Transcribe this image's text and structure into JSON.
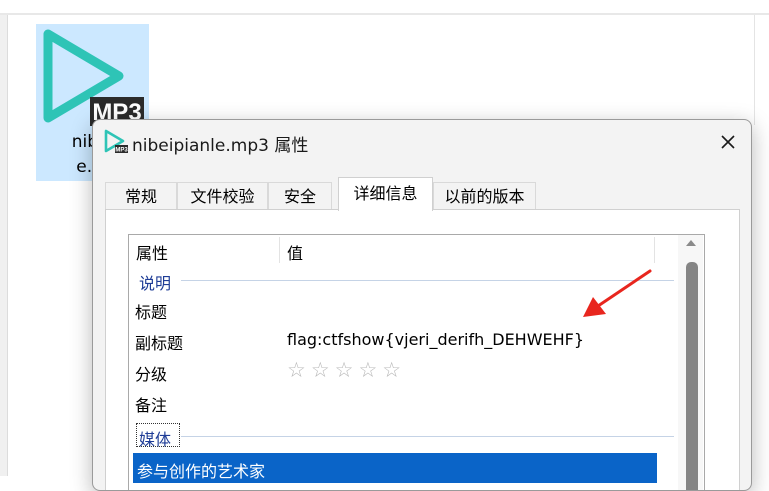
{
  "file": {
    "name_line1": "nibei",
    "name_line2": "e.m",
    "badge": "MP3"
  },
  "dialog": {
    "title": "nibeipianle.mp3 属性",
    "tabs": [
      {
        "label": "常规"
      },
      {
        "label": "文件校验"
      },
      {
        "label": "安全"
      },
      {
        "label": "详细信息"
      },
      {
        "label": "以前的版本"
      }
    ],
    "active_tab": "详细信息",
    "columns": {
      "property": "属性",
      "value": "值"
    },
    "groups": {
      "description": "说明",
      "media": "媒体"
    },
    "rows": [
      {
        "name": "标题",
        "value": ""
      },
      {
        "name": "副标题",
        "value": "flag:ctfshow{vjeri_derifh_DEHWEHF}"
      },
      {
        "name": "分级",
        "value": "☆☆☆☆☆"
      },
      {
        "name": "备注",
        "value": ""
      }
    ],
    "rating_stars": 0,
    "selected_row": "参与创作的艺术家"
  },
  "colors": {
    "accent": "#0a64c8",
    "group_text": "#1e3c96",
    "annotation_arrow": "#e8261e",
    "icon_teal": "#2ec4b6"
  }
}
